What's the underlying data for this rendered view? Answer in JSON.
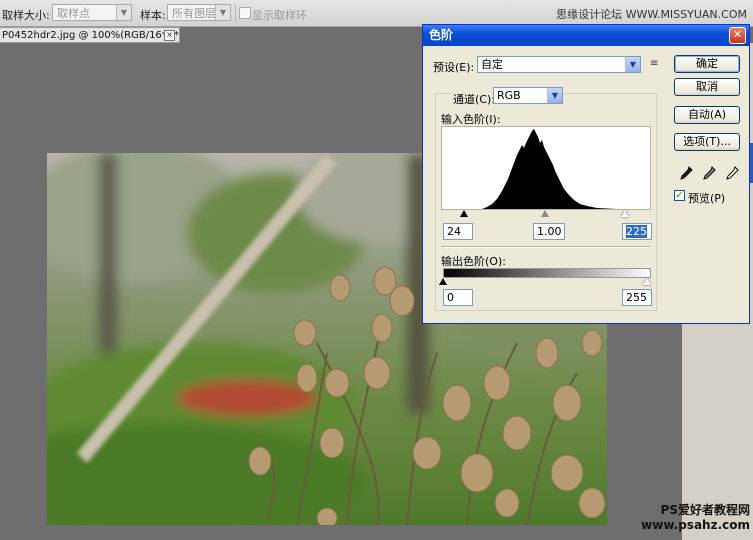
{
  "options_bar": {
    "sample_size_label": "取样大小:",
    "sample_size_value": "取样点",
    "sample_label": "样本:",
    "sample_value": "所有图层",
    "show_ring_label": "显示取样环",
    "watermark": "思缘设计论坛 WWW.MISSYUAN.COM"
  },
  "document_tab": {
    "title": "P0452hdr2.jpg @ 100%(RGB/16*) *",
    "close_glyph": "×"
  },
  "dialog": {
    "title": "色阶",
    "close_glyph": "✕",
    "preset_label": "预设(E):",
    "preset_value": "自定",
    "preset_menu_icon": "≡",
    "channel_label": "通道(C):",
    "channel_value": "RGB",
    "input_levels_label": "输入色阶(I):",
    "input_black": "24",
    "input_gamma": "1.00",
    "input_white": "225",
    "output_levels_label": "输出色阶(O):",
    "output_black": "0",
    "output_white": "255",
    "buttons": {
      "ok": "确定",
      "cancel": "取消",
      "auto": "自动(A)",
      "options": "选项(T)..."
    },
    "preview_label": "预览(P)",
    "preview_checked": true,
    "checkmark_glyph": "✓"
  },
  "footer_watermark": {
    "line1": "PS爱好者教程网",
    "line2": "www.psahz.com"
  },
  "colors": {
    "titlebar": "#0a4fd8",
    "dialog_bg": "#ece9d8",
    "workspace": "#6e6e6e"
  }
}
